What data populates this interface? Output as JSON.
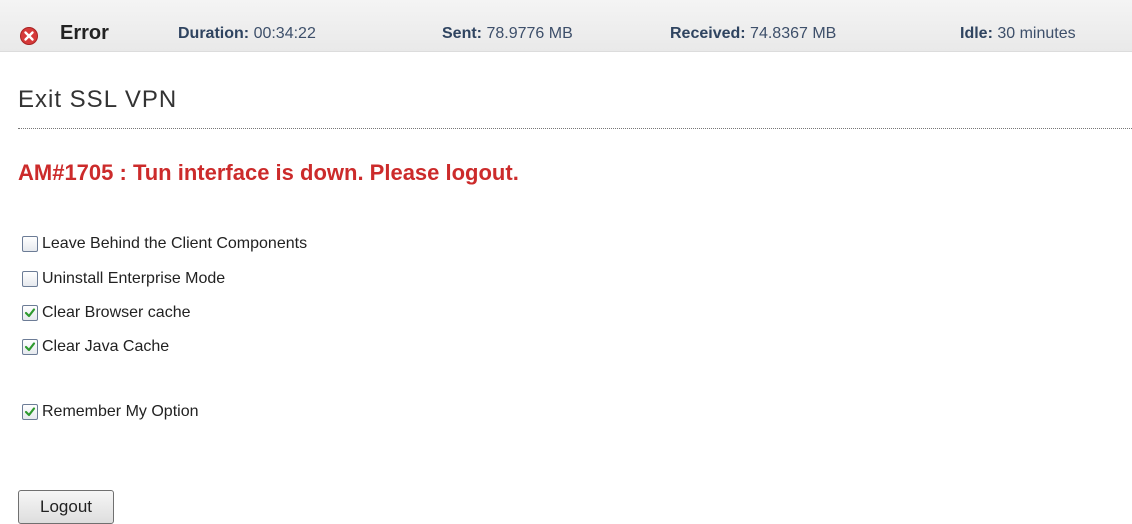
{
  "status": {
    "icon": "error-icon",
    "label": "Error",
    "duration_label": "Duration:",
    "duration_value": "00:34:22",
    "sent_label": "Sent:",
    "sent_value": "78.9776 MB",
    "received_label": "Received:",
    "received_value": "74.8367 MB",
    "idle_label": "Idle:",
    "idle_value": "30 minutes"
  },
  "page": {
    "title": "Exit SSL VPN",
    "error_message": "AM#1705 : Tun interface is down. Please logout."
  },
  "options": [
    {
      "label": "Leave Behind the Client Components",
      "checked": false
    },
    {
      "label": "Uninstall Enterprise Mode",
      "checked": false
    },
    {
      "label": "Clear Browser cache",
      "checked": true
    },
    {
      "label": "Clear Java Cache",
      "checked": true
    }
  ],
  "remember": {
    "label": "Remember My Option",
    "checked": true
  },
  "logout_label": "Logout",
  "colors": {
    "error_text": "#cc2b2b",
    "check_green": "#2f9a2f",
    "error_icon": "#d63a3a"
  }
}
